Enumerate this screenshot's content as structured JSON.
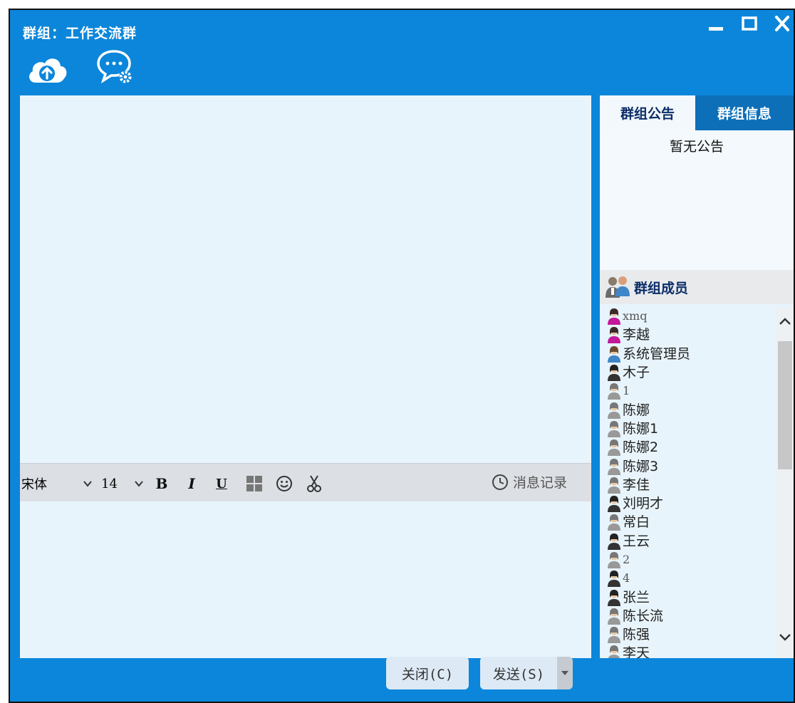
{
  "window": {
    "title": "群组：工作交流群",
    "minimize": "▁",
    "maximize": "☐",
    "close": "X"
  },
  "toolbar": {
    "upload_icon": "cloud-upload-icon",
    "chat_settings_icon": "chat-settings-icon"
  },
  "format_bar": {
    "font": "宋体",
    "size": "14",
    "bold": "B",
    "italic": "I",
    "underline": "U",
    "history_label": "消息记录"
  },
  "side": {
    "tabs": [
      {
        "label": "群组公告",
        "active": true
      },
      {
        "label": "群组信息",
        "active": false
      }
    ],
    "notice_text": "暂无公告",
    "members_title": "群组成员",
    "members": [
      {
        "name": "xmq",
        "avatar": "female",
        "latin": true
      },
      {
        "name": "李越",
        "avatar": "female",
        "latin": false
      },
      {
        "name": "系统管理员",
        "avatar": "admin",
        "latin": false
      },
      {
        "name": "木子",
        "avatar": "female-dark",
        "latin": false
      },
      {
        "name": "1",
        "avatar": "male-grey",
        "latin": true
      },
      {
        "name": "陈娜",
        "avatar": "male-grey",
        "latin": false
      },
      {
        "name": "陈娜1",
        "avatar": "male-grey",
        "latin": false
      },
      {
        "name": "陈娜2",
        "avatar": "male-grey",
        "latin": false
      },
      {
        "name": "陈娜3",
        "avatar": "male-grey",
        "latin": false
      },
      {
        "name": "李佳",
        "avatar": "male-grey",
        "latin": false
      },
      {
        "name": "刘明才",
        "avatar": "female-dark",
        "latin": false
      },
      {
        "name": "常白",
        "avatar": "male-grey",
        "latin": false
      },
      {
        "name": "王云",
        "avatar": "female-dark",
        "latin": false
      },
      {
        "name": "2",
        "avatar": "male-grey",
        "latin": true
      },
      {
        "name": "4",
        "avatar": "female-dark",
        "latin": true
      },
      {
        "name": "张兰",
        "avatar": "female-dark",
        "latin": false
      },
      {
        "name": "陈长流",
        "avatar": "male-grey",
        "latin": false
      },
      {
        "name": "陈强",
        "avatar": "male-grey",
        "latin": false
      },
      {
        "name": "李天",
        "avatar": "male-grey",
        "latin": false
      }
    ]
  },
  "buttons": {
    "close": "关闭(C)",
    "send": "发送(S)"
  },
  "colors": {
    "window_blue": "#0c86da",
    "chat_bg": "#e8f4fb",
    "tab_inactive": "#0c6fb8",
    "tab_text_active": "#0b2d66"
  }
}
